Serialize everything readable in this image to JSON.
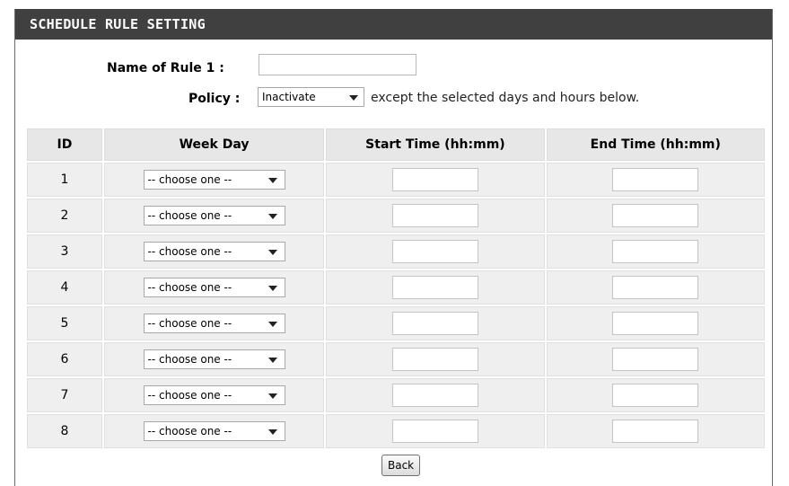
{
  "section": {
    "title": "SCHEDULE RULE SETTING"
  },
  "form": {
    "name_label": "Name of Rule 1 :",
    "name_value": "",
    "policy_label": "Policy :",
    "policy_selected": "Inactivate",
    "policy_suffix": "except the selected days and hours below."
  },
  "table": {
    "headers": [
      "ID",
      "Week Day",
      "Start Time (hh:mm)",
      "End Time (hh:mm)"
    ],
    "rows": [
      {
        "id": "1",
        "week_day": "-- choose one --",
        "start": "",
        "end": ""
      },
      {
        "id": "2",
        "week_day": "-- choose one --",
        "start": "",
        "end": ""
      },
      {
        "id": "3",
        "week_day": "-- choose one --",
        "start": "",
        "end": ""
      },
      {
        "id": "4",
        "week_day": "-- choose one --",
        "start": "",
        "end": ""
      },
      {
        "id": "5",
        "week_day": "-- choose one --",
        "start": "",
        "end": ""
      },
      {
        "id": "6",
        "week_day": "-- choose one --",
        "start": "",
        "end": ""
      },
      {
        "id": "7",
        "week_day": "-- choose one --",
        "start": "",
        "end": ""
      },
      {
        "id": "8",
        "week_day": "-- choose one --",
        "start": "",
        "end": ""
      }
    ]
  },
  "buttons": {
    "back_label": "Back"
  },
  "colors": {
    "title_bar": "#404040",
    "header_cell": "#e7e7e7",
    "body_cell": "#efefef"
  }
}
